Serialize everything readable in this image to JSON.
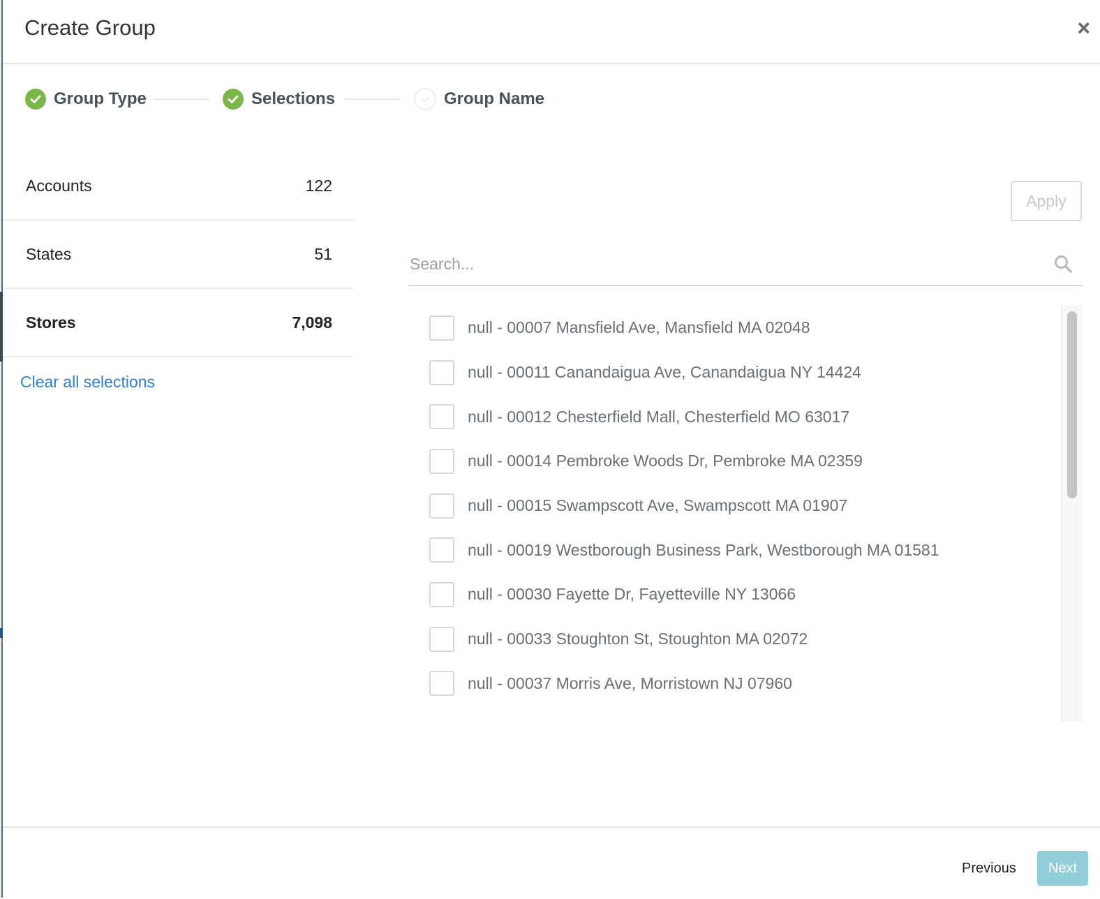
{
  "modal": {
    "title": "Create Group",
    "close_symbol": "×"
  },
  "stepper": {
    "steps": [
      {
        "label": "Group Type",
        "status": "complete"
      },
      {
        "label": "Selections",
        "status": "complete"
      },
      {
        "label": "Group Name",
        "status": "pending"
      }
    ]
  },
  "facets": [
    {
      "name": "Accounts",
      "count": "122",
      "active": false
    },
    {
      "name": "States",
      "count": "51",
      "active": false
    },
    {
      "name": "Stores",
      "count": "7,098",
      "active": true
    }
  ],
  "clear_link": "Clear all selections",
  "apply_label": "Apply",
  "search": {
    "placeholder": "Search...",
    "value": ""
  },
  "stores": [
    {
      "label": "null - 00007 Mansfield Ave, Mansfield MA 02048",
      "checked": false
    },
    {
      "label": "null - 00011 Canandaigua Ave, Canandaigua NY 14424",
      "checked": false
    },
    {
      "label": "null - 00012 Chesterfield Mall, Chesterfield MO 63017",
      "checked": false
    },
    {
      "label": "null - 00014 Pembroke Woods Dr, Pembroke MA 02359",
      "checked": false
    },
    {
      "label": "null - 00015 Swampscott Ave, Swampscott MA 01907",
      "checked": false
    },
    {
      "label": "null - 00019 Westborough Business Park, Westborough MA 01581",
      "checked": false
    },
    {
      "label": "null - 00030 Fayette Dr, Fayetteville NY 13066",
      "checked": false
    },
    {
      "label": "null - 00033 Stoughton St, Stoughton MA 02072",
      "checked": false
    },
    {
      "label": "null - 00037 Morris Ave, Morristown NJ 07960",
      "checked": false
    }
  ],
  "footer": {
    "previous_label": "Previous",
    "next_label": "Next"
  },
  "colors": {
    "step_complete": "#7ab648",
    "link": "#2f7fd6",
    "next_button": "#93cfdb"
  },
  "icons": {
    "close": "close-icon",
    "step_complete": "check-circle-icon",
    "step_pending": "check-circle-outline-icon",
    "search": "search-icon"
  }
}
